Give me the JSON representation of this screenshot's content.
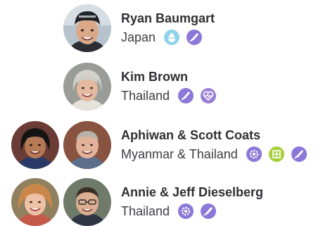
{
  "people": [
    {
      "name": "Ryan Baumgart",
      "location": "Japan",
      "avatars": [
        "ryan-baumgart"
      ],
      "badges": [
        {
          "icon": "water-drop-icon",
          "color": "#8fd2ea"
        },
        {
          "icon": "pen-nib-icon",
          "color": "#8c78d8"
        }
      ]
    },
    {
      "name": "Kim Brown",
      "location": "Thailand",
      "avatars": [
        "kim-brown"
      ],
      "badges": [
        {
          "icon": "pen-nib-icon",
          "color": "#8c78d8"
        },
        {
          "icon": "heartbeat-icon",
          "color": "#9a7ed6"
        }
      ]
    },
    {
      "name": "Aphiwan & Scott Coats",
      "location": "Myanmar & Thailand",
      "avatars": [
        "aphiwan-coats",
        "scott-coats"
      ],
      "badges": [
        {
          "icon": "gear-icon",
          "color": "#8c78d8"
        },
        {
          "icon": "puzzle-icon",
          "color": "#a8cf3a"
        },
        {
          "icon": "pen-nib-icon",
          "color": "#8c78d8"
        }
      ]
    },
    {
      "name": "Annie & Jeff Dieselberg",
      "location": "Thailand",
      "avatars": [
        "annie-dieselberg",
        "jeff-dieselberg"
      ],
      "badges": [
        {
          "icon": "gear-icon",
          "color": "#8c78d8"
        },
        {
          "icon": "pen-nib-icon",
          "color": "#8c78d8"
        }
      ]
    }
  ]
}
